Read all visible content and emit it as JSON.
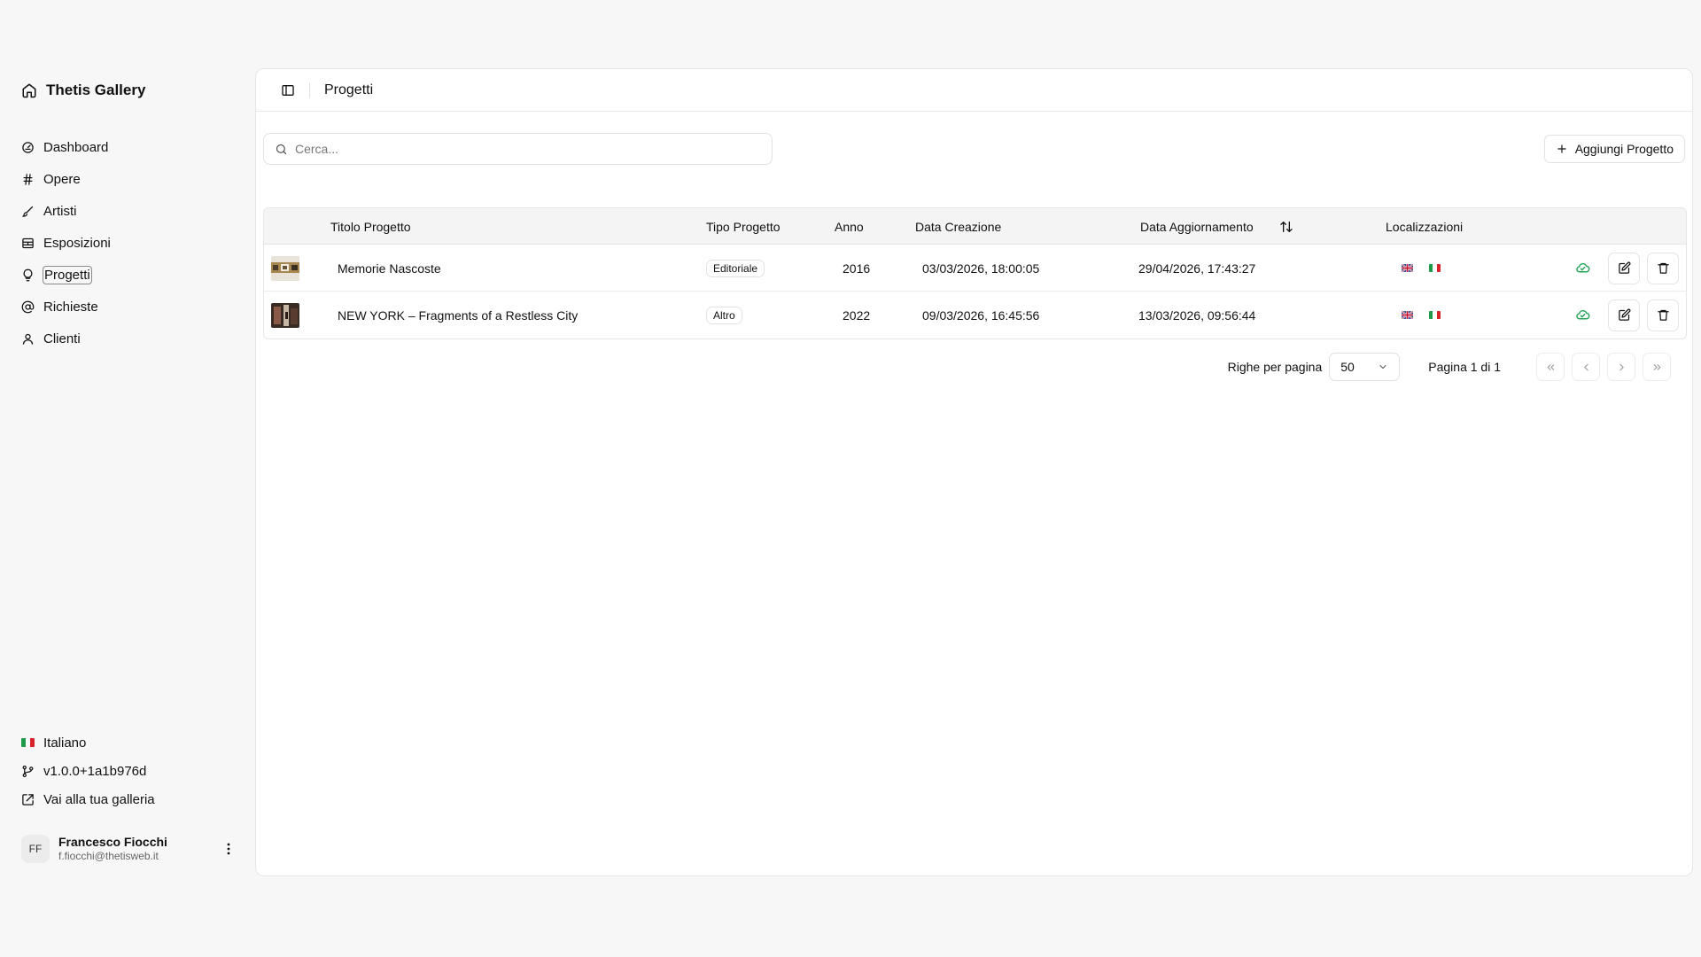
{
  "app": {
    "title": "Thetis Gallery"
  },
  "sidebar": {
    "items": [
      {
        "label": "Dashboard",
        "icon": "gauge-icon"
      },
      {
        "label": "Opere",
        "icon": "hash-icon"
      },
      {
        "label": "Artisti",
        "icon": "brush-icon"
      },
      {
        "label": "Esposizioni",
        "icon": "gallery-icon"
      },
      {
        "label": "Progetti",
        "icon": "lightbulb-icon",
        "active": true
      },
      {
        "label": "Richieste",
        "icon": "at-sign-icon"
      },
      {
        "label": "Clienti",
        "icon": "user-icon"
      }
    ],
    "language": "Italiano",
    "version": "v1.0.0+1a1b976d",
    "gallery_link": "Vai alla tua galleria",
    "user": {
      "initials": "FF",
      "name": "Francesco Fiocchi",
      "email": "f.fiocchi@thetisweb.it"
    }
  },
  "header": {
    "title": "Progetti"
  },
  "search": {
    "placeholder": "Cerca...",
    "value": ""
  },
  "toolbar": {
    "add_label": "Aggiungi Progetto"
  },
  "table": {
    "columns": [
      "Titolo Progetto",
      "Tipo Progetto",
      "Anno",
      "Data Creazione",
      "Data Aggiornamento",
      "Localizzazioni"
    ],
    "rows": [
      {
        "title": "Memorie Nascoste",
        "type": "Editoriale",
        "year": "2016",
        "created": "03/03/2026, 18:00:05",
        "updated": "29/04/2026, 17:43:27"
      },
      {
        "title": "NEW YORK – Fragments of a Restless City",
        "type": "Altro",
        "year": "2022",
        "created": "09/03/2026, 16:45:56",
        "updated": "13/03/2026, 09:56:44"
      }
    ]
  },
  "pagination": {
    "rows_per_page_label": "Righe per pagina",
    "rows_per_page_value": "50",
    "page_info": "Pagina 1 di 1"
  },
  "colors": {
    "published_green": "#22a355",
    "flag_green": "#1f9a48",
    "flag_red": "#d8232a"
  }
}
